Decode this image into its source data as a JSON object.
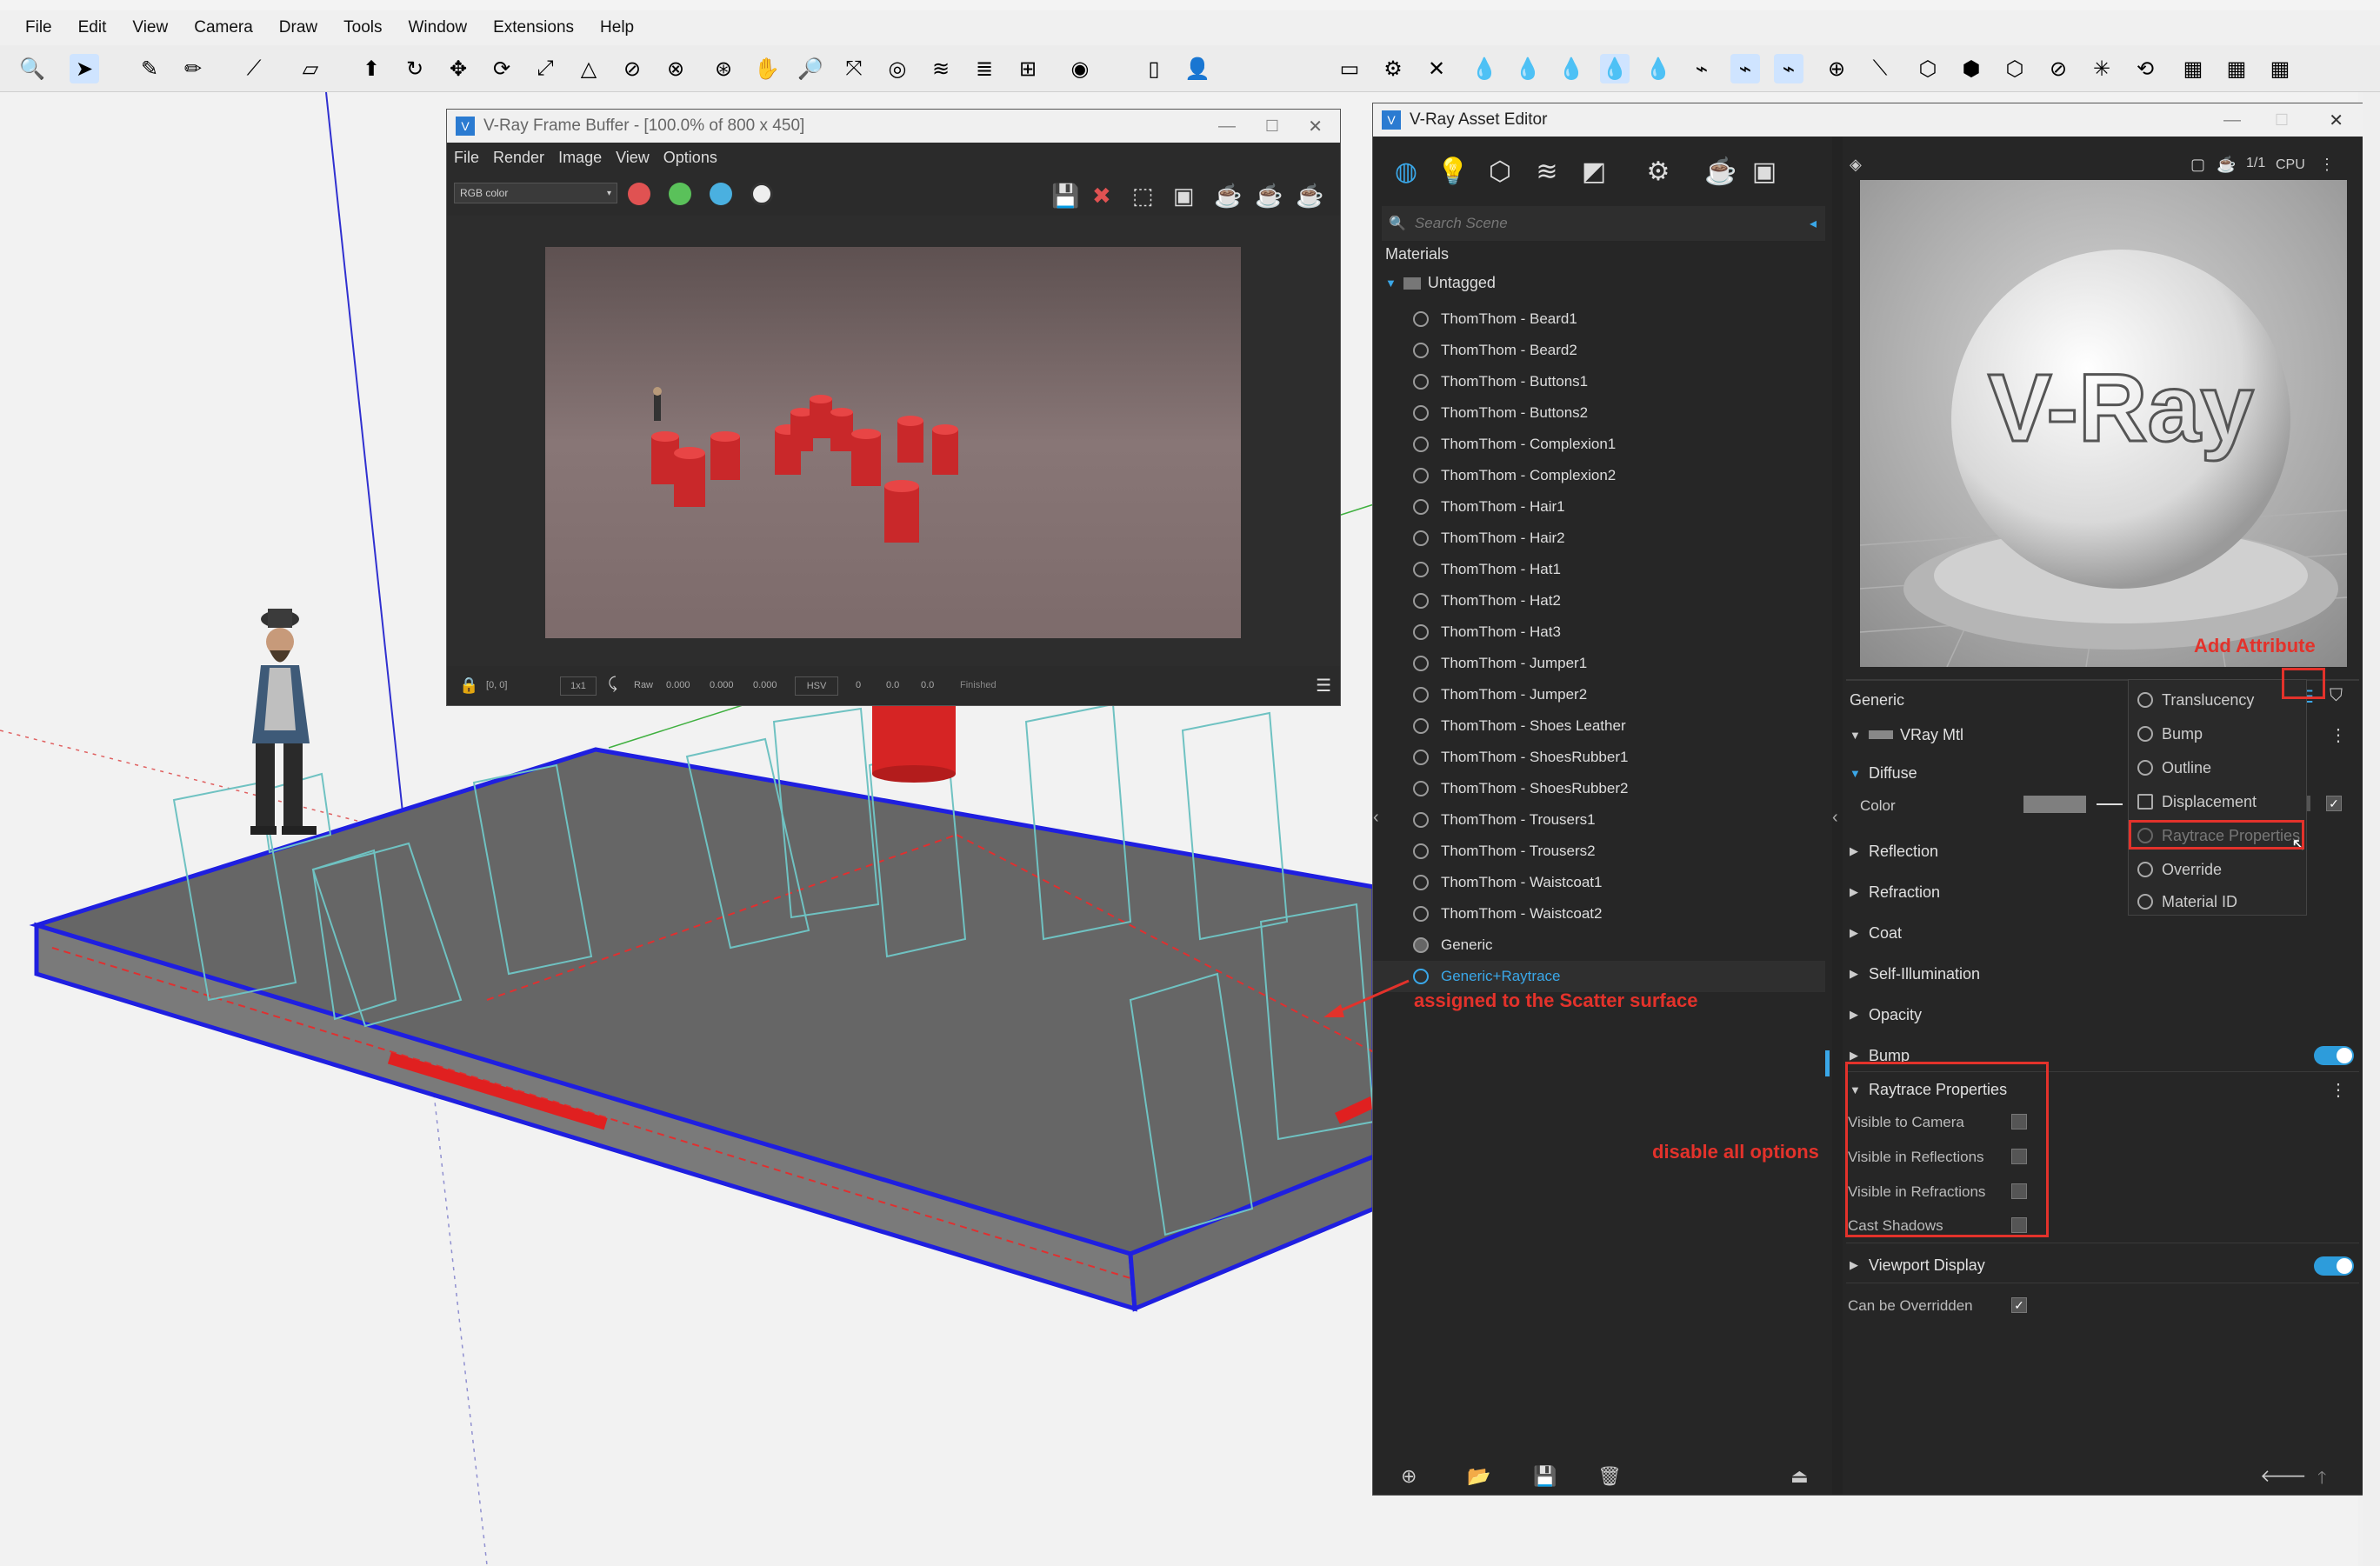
{
  "menubar": {
    "items": [
      "File",
      "Edit",
      "View",
      "Camera",
      "Draw",
      "Tools",
      "Window",
      "Extensions",
      "Help"
    ]
  },
  "vfb": {
    "title": "V-Ray Frame Buffer - [100.0% of 800 x 450]",
    "menu": [
      "File",
      "Render",
      "Image",
      "View",
      "Options"
    ],
    "channel_select": "RGB color",
    "status": {
      "coords": "[0, 0]",
      "zoom": "1x1",
      "raw": "Raw",
      "v1": "0.000",
      "v2": "0.000",
      "v3": "0.000",
      "color_mode": "HSV",
      "h": "0",
      "s": "0.0",
      "v": "0.0",
      "state": "Finished"
    }
  },
  "asset_editor": {
    "title": "V-Ray Asset Editor",
    "search_placeholder": "Search Scene",
    "section_label": "Materials",
    "group_label": "Untagged",
    "materials": [
      "ThomThom - Beard1",
      "ThomThom - Beard2",
      "ThomThom - Buttons1",
      "ThomThom - Buttons2",
      "ThomThom - Complexion1",
      "ThomThom - Complexion2",
      "ThomThom - Hair1",
      "ThomThom - Hair2",
      "ThomThom - Hat1",
      "ThomThom - Hat2",
      "ThomThom - Hat3",
      "ThomThom - Jumper1",
      "ThomThom - Jumper2",
      "ThomThom - Shoes Leather",
      "ThomThom - ShoesRubber1",
      "ThomThom - ShoesRubber2",
      "ThomThom - Trousers1",
      "ThomThom - Trousers2",
      "ThomThom - Waistcoat1",
      "ThomThom - Waistcoat2",
      "Generic",
      "Generic+Raytrace"
    ],
    "selected_material": "Generic+Raytrace",
    "preview_mode": "CPU",
    "preview_ratio": "1/1",
    "preview_text": "V-Ray",
    "material_name": "Generic",
    "material_type": "VRay Mtl",
    "diffuse": {
      "label": "Diffuse",
      "color_label": "Color"
    },
    "sections": [
      "Reflection",
      "Refraction",
      "Coat",
      "Self-Illumination",
      "Opacity",
      "Bump"
    ],
    "raytrace": {
      "label": "Raytrace Properties",
      "options": [
        {
          "label": "Visible to Camera",
          "checked": false
        },
        {
          "label": "Visible in Reflections",
          "checked": false
        },
        {
          "label": "Visible in Refractions",
          "checked": false
        },
        {
          "label": "Cast Shadows",
          "checked": false
        }
      ]
    },
    "viewport_display": "Viewport Display",
    "can_be_overridden": {
      "label": "Can be Overridden",
      "checked": true
    },
    "add_attribute_menu": [
      "Translucency",
      "Bump",
      "Outline",
      "Displacement",
      "Raytrace Properties",
      "Override",
      "Material ID"
    ]
  },
  "annotations": {
    "add_attribute": "Add Attribute",
    "assigned": "assigned to the Scatter surface",
    "disable": "disable all options"
  },
  "colors": {
    "accent": "#2d9cdb",
    "annotation": "#e3322b",
    "selected_text": "#3aa7e8"
  }
}
